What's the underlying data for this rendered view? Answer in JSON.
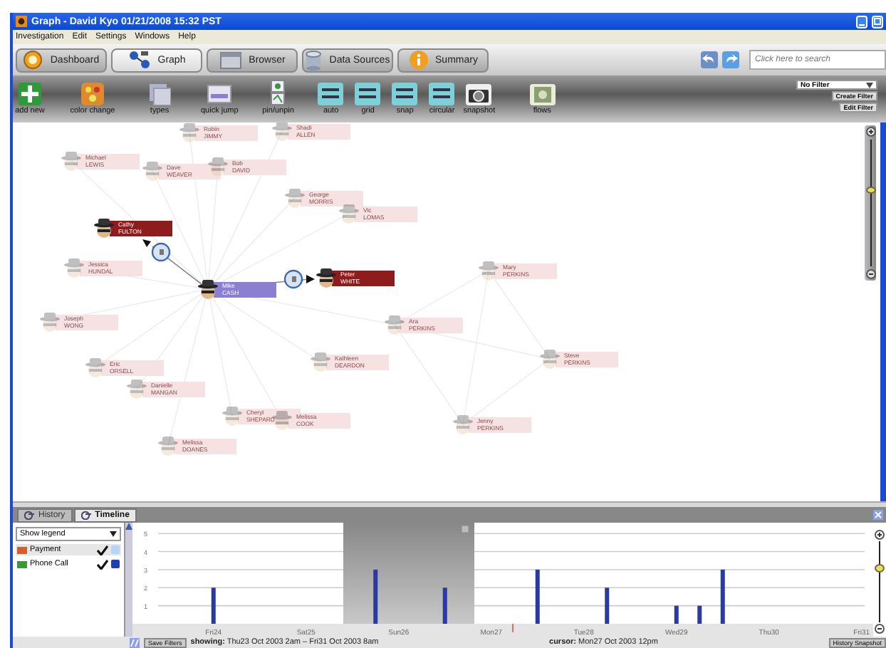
{
  "window": {
    "title": "Graph - David Kyo 01/21/2008 15:32 PST"
  },
  "menu": [
    "Investigation",
    "Edit",
    "Settings",
    "Windows",
    "Help"
  ],
  "tabs": [
    {
      "label": "Dashboard",
      "kind": "dashboard",
      "selected": false
    },
    {
      "label": "Graph",
      "kind": "graph",
      "selected": true
    },
    {
      "label": "Browser",
      "kind": "browser",
      "selected": false
    },
    {
      "label": "Data Sources",
      "kind": "sources",
      "selected": false
    },
    {
      "label": "Summary",
      "kind": "summary",
      "selected": false
    }
  ],
  "search": {
    "placeholder": "Click here to search"
  },
  "toolbar": [
    {
      "label": "add new",
      "kind": "add"
    },
    {
      "label": "color change",
      "kind": "palette"
    },
    {
      "label": "types",
      "kind": "types"
    },
    {
      "label": "quick jump",
      "kind": "jump"
    },
    {
      "label": "pin/unpin",
      "kind": "pin"
    },
    {
      "label": "auto",
      "kind": "layout"
    },
    {
      "label": "grid",
      "kind": "layout"
    },
    {
      "label": "snap",
      "kind": "layout"
    },
    {
      "label": "circular",
      "kind": "layout"
    },
    {
      "label": "snapshot",
      "kind": "camera"
    },
    {
      "label": "flows",
      "kind": "flows"
    }
  ],
  "filter": {
    "value": "No Filter",
    "buttons": [
      "Create Filter",
      "Edit Filter"
    ]
  },
  "graph": {
    "zoom": {
      "level": 0.6
    },
    "nodes": [
      {
        "first": "Robin",
        "last": "JIMMY",
        "kind": "faded"
      },
      {
        "first": "Shadi",
        "last": "ALLEN",
        "kind": "faded"
      },
      {
        "first": "Michael",
        "last": "LEWIS",
        "kind": "faded"
      },
      {
        "first": "Dave",
        "last": "WEAVER",
        "kind": "faded"
      },
      {
        "first": "Bob",
        "last": "DAVID",
        "kind": "faded"
      },
      {
        "first": "George",
        "last": "MORRIS",
        "kind": "faded"
      },
      {
        "first": "Vic",
        "last": "LOMAS",
        "kind": "faded"
      },
      {
        "first": "Cathy",
        "last": "FULTON",
        "kind": "suspect"
      },
      {
        "first": "Jessica",
        "last": "HUNDAL",
        "kind": "faded"
      },
      {
        "first": "Mike",
        "last": "CASH",
        "kind": "focus"
      },
      {
        "first": "Peter",
        "last": "WHITE",
        "kind": "suspect"
      },
      {
        "first": "Joseph",
        "last": "WONG",
        "kind": "faded"
      },
      {
        "first": "Ara",
        "last": "PERKINS",
        "kind": "faded"
      },
      {
        "first": "Eric",
        "last": "ORSELL",
        "kind": "faded"
      },
      {
        "first": "Kathleen",
        "last": "DEARDON",
        "kind": "faded"
      },
      {
        "first": "Danielle",
        "last": "MANGAN",
        "kind": "faded"
      },
      {
        "first": "Cheryl",
        "last": "SHEPARD",
        "kind": "faded"
      },
      {
        "first": "Melissa",
        "last": "COOK",
        "kind": "faded"
      },
      {
        "first": "Melissa",
        "last": "DOANES",
        "kind": "faded"
      },
      {
        "first": "Mary",
        "last": "PERKINS",
        "kind": "faded"
      },
      {
        "first": "Steve",
        "last": "PERKINS",
        "kind": "faded"
      },
      {
        "first": "Jenny",
        "last": "PERKINS",
        "kind": "faded"
      }
    ]
  },
  "panel_tabs": [
    {
      "label": "History",
      "selected": false
    },
    {
      "label": "Timeline",
      "selected": true
    }
  ],
  "legend": {
    "dropdown": "Show legend",
    "items": [
      {
        "label": "Payment",
        "checked": true,
        "selected": true,
        "color": "#b8d4f4"
      },
      {
        "label": "Phone Call",
        "checked": true,
        "selected": false,
        "color": "#2040b0"
      }
    ]
  },
  "timeline": {
    "zoom": {
      "level": 0.67
    },
    "chart_data": {
      "type": "bar",
      "categories": [
        null,
        null,
        null,
        "Fri24",
        null,
        null,
        null,
        "Sat25",
        null,
        null,
        null,
        "Sun26",
        null,
        null,
        null,
        "Mon27",
        null,
        null,
        null,
        "Tue28",
        null,
        null,
        null,
        "Wed29",
        null,
        null,
        null,
        "Thu30",
        null,
        null,
        null,
        "Fri31"
      ],
      "values": [
        null,
        null,
        null,
        2,
        null,
        null,
        null,
        null,
        null,
        null,
        3,
        null,
        null,
        2,
        null,
        null,
        null,
        3,
        null,
        null,
        2,
        null,
        null,
        1,
        1,
        3,
        null,
        null,
        null,
        null,
        null,
        null
      ],
      "ylim": [
        0,
        5.6
      ],
      "yticks": [
        1,
        2,
        3,
        4,
        5
      ],
      "grid": true
    }
  },
  "status": {
    "save_button": "Save Filters",
    "showing": "**showing:** Thu23 Oct 2003 2am – Fri31 Oct 2003 8am",
    "cursor": "**cursor:** Mon27 Oct 2003 12pm",
    "snapshot_button": "History Snapshot"
  }
}
